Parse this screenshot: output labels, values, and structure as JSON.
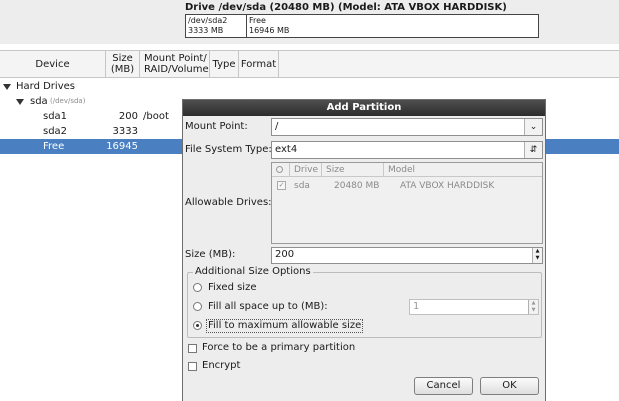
{
  "disk_map": {
    "title": "Drive /dev/sda (20480 MB) (Model: ATA VBOX HARDDISK)",
    "segments": [
      {
        "name": "/dev/sda2",
        "size": "3333 MB"
      },
      {
        "name": "Free",
        "size": "16946 MB"
      }
    ]
  },
  "table": {
    "columns": [
      "Device",
      "Size (MB)",
      "Mount Point/ RAID/Volume",
      "Type",
      "Format"
    ],
    "tree": {
      "root": "Hard Drives",
      "disk": {
        "name": "sda",
        "path": "(/dev/sda)"
      },
      "rows": [
        {
          "device": "sda1",
          "size": "200",
          "mount": "/boot"
        },
        {
          "device": "sda2",
          "size": "3333",
          "mount": ""
        },
        {
          "device": "Free",
          "size": "16945",
          "mount": ""
        }
      ]
    },
    "selected_row": "Free"
  },
  "dialog": {
    "title": "Add Partition",
    "mount_point": {
      "label": "Mount Point:",
      "value": "/"
    },
    "fs_type": {
      "label": "File System Type:",
      "value": "ext4"
    },
    "allowable_drives": {
      "label": "Allowable Drives:",
      "columns": [
        "",
        "Drive",
        "Size",
        "Model"
      ],
      "rows": [
        {
          "checked": true,
          "drive": "sda",
          "size": "20480 MB",
          "model": "ATA VBOX HARDDISK"
        }
      ]
    },
    "size": {
      "label": "Size (MB):",
      "value": "200"
    },
    "size_options": {
      "legend": "Additional Size Options",
      "fixed": "Fixed size",
      "fill_up_to": "Fill all space up to (MB):",
      "fill_up_to_value": "1",
      "fill_max": "Fill to maximum allowable size",
      "selected": "fill_max"
    },
    "primary": {
      "label": "Force to be a primary partition",
      "checked": false
    },
    "encrypt": {
      "label": "Encrypt",
      "checked": false
    },
    "cancel": "Cancel",
    "ok": "OK"
  },
  "colors": {
    "selection": "#4a7fc1",
    "title_bar": "#2c2c2c"
  }
}
